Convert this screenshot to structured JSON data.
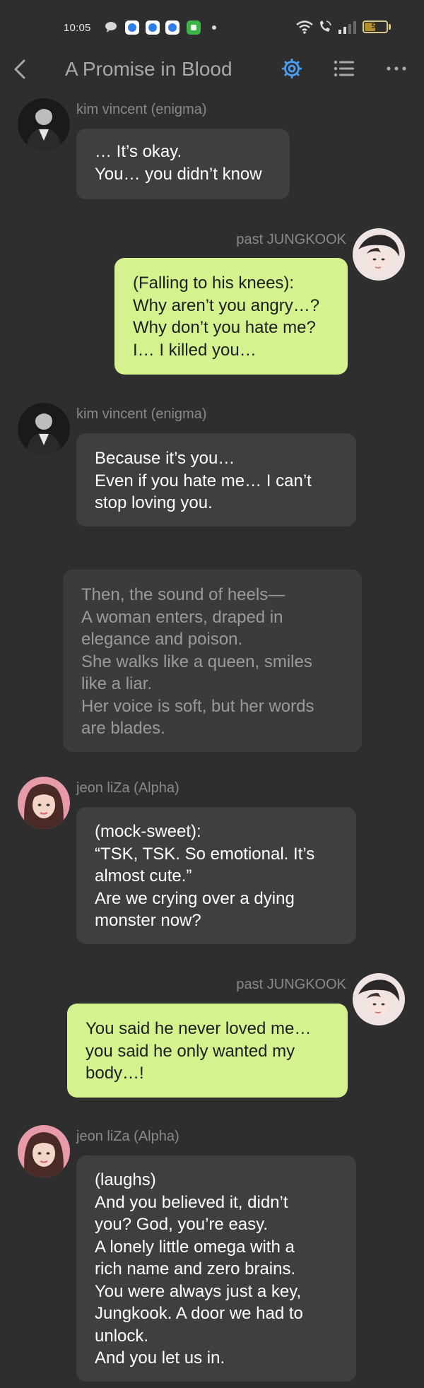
{
  "status_bar": {
    "time": "10:05",
    "battery": "51",
    "battery_level": 0.51
  },
  "nav": {
    "title": "A Promise in Blood",
    "accent_color": "#4a9ef5"
  },
  "messages": [
    {
      "sender": "kim vincent (enigma)",
      "lines": [
        "… It’s okay.",
        "You… you didn’t know"
      ]
    },
    {
      "sender": "past JUNGKOOK",
      "lines": [
        "(Falling to his knees):",
        "Why aren’t you angry…?",
        "Why don’t you hate me?",
        "I… I killed you…"
      ]
    },
    {
      "sender": "kim vincent (enigma)",
      "lines": [
        "Because it’s you…",
        "Even if you hate me… I can’t",
        "stop loving you."
      ]
    },
    {
      "sender": "",
      "lines": [
        "Then, the sound of heels—",
        "A woman enters, draped in",
        "elegance and poison.",
        "She walks like a queen, smiles",
        "like a liar.",
        "Her voice is soft, but her words",
        "are blades."
      ]
    },
    {
      "sender": "jeon liZa (Alpha)",
      "lines": [
        "(mock-sweet):",
        "“TSK, TSK. So emotional. It’s",
        "almost cute.”",
        "Are we crying over a dying",
        "monster now?"
      ]
    },
    {
      "sender": "past JUNGKOOK",
      "lines": [
        "You said he never loved me…",
        "you said he only wanted my",
        "body…!"
      ]
    },
    {
      "sender": "jeon liZa (Alpha)",
      "lines": [
        "(laughs)",
        "And you believed it, didn’t",
        "you? God, you’re easy.",
        "A lonely little omega with a",
        "rich name and zero brains.",
        "You were always just a key,",
        "Jungkook. A door we had to",
        "unlock.",
        "And you let us in."
      ]
    }
  ]
}
